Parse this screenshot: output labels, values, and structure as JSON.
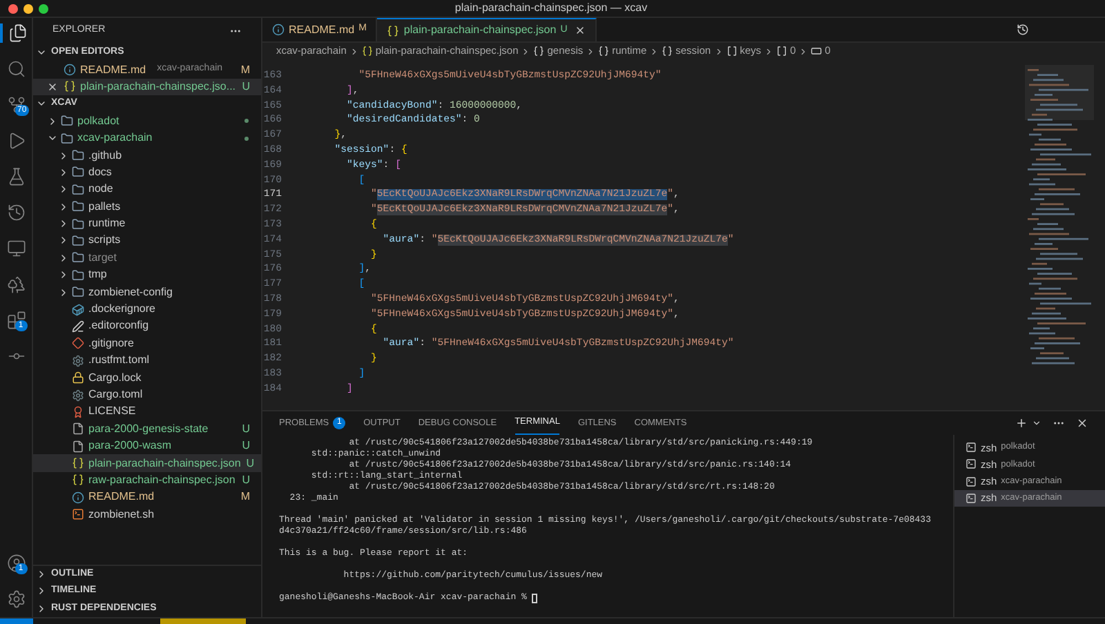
{
  "window": {
    "title": "plain-parachain-chainspec.json — xcav"
  },
  "activity_bar": {
    "items": [
      {
        "kind": "files",
        "selected": true
      },
      {
        "kind": "search",
        "selected": false
      },
      {
        "kind": "source-control",
        "selected": false,
        "badge": "70"
      },
      {
        "kind": "run",
        "selected": false
      },
      {
        "kind": "testing",
        "selected": false
      },
      {
        "kind": "history",
        "selected": false
      },
      {
        "kind": "remote",
        "selected": false
      },
      {
        "kind": "tree",
        "selected": false
      },
      {
        "kind": "extensions",
        "selected": false,
        "badge": "1"
      },
      {
        "kind": "commit",
        "selected": false
      }
    ],
    "bottom": [
      {
        "kind": "account",
        "badge": "1"
      },
      {
        "kind": "settings"
      }
    ]
  },
  "sidebar": {
    "title": "EXPLORER",
    "open_editors": {
      "title": "OPEN EDITORS",
      "expanded": true,
      "items": [
        {
          "name": "README.md",
          "description": "xcav-parachain",
          "badge": "M",
          "color": "#e2c08d",
          "kind": "info",
          "selected": false,
          "closable": false
        },
        {
          "name": "plain-parachain-chainspec.jso...",
          "badge": "U",
          "color": "#73c991",
          "kind": "json",
          "selected": true,
          "closable": true
        }
      ]
    },
    "workspace": {
      "title": "XCAV",
      "expanded": true,
      "tree": [
        {
          "name": "polkadot",
          "kind": "folder",
          "expanded": false,
          "color": "#73c991",
          "dot": true,
          "selected": false
        },
        {
          "name": "xcav-parachain",
          "kind": "folder",
          "expanded": true,
          "color": "#73c991",
          "dot": true,
          "selected": false,
          "children": [
            {
              "name": ".github",
              "kind": "folder",
              "expanded": false,
              "color": "#cccccc",
              "selected": false
            },
            {
              "name": "docs",
              "kind": "folder",
              "expanded": false,
              "color": "#cccccc",
              "selected": false
            },
            {
              "name": "node",
              "kind": "folder",
              "expanded": false,
              "color": "#cccccc",
              "selected": false
            },
            {
              "name": "pallets",
              "kind": "folder",
              "expanded": false,
              "color": "#cccccc",
              "selected": false
            },
            {
              "name": "runtime",
              "kind": "folder",
              "expanded": false,
              "color": "#cccccc",
              "selected": false
            },
            {
              "name": "scripts",
              "kind": "folder",
              "expanded": false,
              "color": "#cccccc",
              "selected": false
            },
            {
              "name": "target",
              "kind": "folder",
              "expanded": false,
              "color": "#8c8c8c",
              "selected": false
            },
            {
              "name": "tmp",
              "kind": "folder",
              "expanded": false,
              "color": "#cccccc",
              "selected": false
            },
            {
              "name": "zombienet-config",
              "kind": "folder",
              "expanded": false,
              "color": "#cccccc",
              "selected": false
            },
            {
              "name": ".dockerignore",
              "kind": "docker",
              "color": "#cccccc",
              "selected": false
            },
            {
              "name": ".editorconfig",
              "kind": "editorconfig",
              "color": "#cccccc",
              "selected": false
            },
            {
              "name": ".gitignore",
              "kind": "git",
              "color": "#cccccc",
              "selected": false
            },
            {
              "name": ".rustfmt.toml",
              "kind": "gear",
              "color": "#cccccc",
              "selected": false
            },
            {
              "name": "Cargo.lock",
              "kind": "lock",
              "color": "#cccccc",
              "selected": false
            },
            {
              "name": "Cargo.toml",
              "kind": "gear",
              "color": "#cccccc",
              "selected": false
            },
            {
              "name": "LICENSE",
              "kind": "license",
              "color": "#cccccc",
              "selected": false
            },
            {
              "name": "para-2000-genesis-state",
              "kind": "file",
              "color": "#73c991",
              "badge": "U",
              "selected": false
            },
            {
              "name": "para-2000-wasm",
              "kind": "file",
              "color": "#73c991",
              "badge": "U",
              "selected": false
            },
            {
              "name": "plain-parachain-chainspec.json",
              "kind": "json",
              "color": "#73c991",
              "badge": "U",
              "selected": true
            },
            {
              "name": "raw-parachain-chainspec.json",
              "kind": "json",
              "color": "#73c991",
              "badge": "U",
              "selected": false
            },
            {
              "name": "README.md",
              "kind": "info",
              "color": "#e2c08d",
              "badge": "M",
              "selected": false
            },
            {
              "name": "zombienet.sh",
              "kind": "shell",
              "color": "#cccccc",
              "selected": false
            }
          ]
        }
      ]
    },
    "sections": [
      {
        "title": "OUTLINE",
        "expanded": false
      },
      {
        "title": "TIMELINE",
        "expanded": false
      },
      {
        "title": "RUST DEPENDENCIES",
        "expanded": false
      }
    ]
  },
  "tabs": [
    {
      "label": "README.md",
      "badge": "M",
      "kind": "info",
      "color": "#e2c08d",
      "selected": false,
      "closable": false
    },
    {
      "label": "plain-parachain-chainspec.json",
      "badge": "U",
      "kind": "json",
      "color": "#73c991",
      "selected": true,
      "closable": true
    }
  ],
  "breadcrumbs": [
    {
      "kind": "none",
      "label": "xcav-parachain"
    },
    {
      "kind": "json",
      "label": "plain-parachain-chainspec.json"
    },
    {
      "kind": "object",
      "label": "genesis"
    },
    {
      "kind": "object",
      "label": "runtime"
    },
    {
      "kind": "object",
      "label": "session"
    },
    {
      "kind": "array",
      "label": "keys"
    },
    {
      "kind": "array",
      "label": "0"
    },
    {
      "kind": "string",
      "label": "0"
    }
  ],
  "code": {
    "lines": [
      {
        "number": "163",
        "current": false,
        "tokens": [
          {
            "kind": "string",
            "text": "\"5FHneW46xGXgs5mUiveU4sbTyGBzmstUspZC92UhjJM694ty\""
          }
        ]
      },
      {
        "number": "164",
        "current": false,
        "tokens": [
          {
            "kind": "close",
            "text": "]"
          },
          {
            "kind": "punct",
            "text": ","
          }
        ]
      },
      {
        "number": "165",
        "current": false,
        "tokens": [
          {
            "kind": "key",
            "text": "\"candidacyBond\""
          },
          {
            "kind": "punct",
            "text": ": "
          },
          {
            "kind": "number",
            "text": "16000000000"
          },
          {
            "kind": "punct",
            "text": ","
          }
        ]
      },
      {
        "number": "166",
        "current": false,
        "tokens": [
          {
            "kind": "key",
            "text": "\"desiredCandidates\""
          },
          {
            "kind": "punct",
            "text": ": "
          },
          {
            "kind": "number",
            "text": "0"
          }
        ]
      },
      {
        "number": "167",
        "current": false,
        "tokens": [
          {
            "kind": "close",
            "text": "}"
          },
          {
            "kind": "punct",
            "text": ","
          }
        ]
      },
      {
        "number": "168",
        "current": false,
        "tokens": [
          {
            "kind": "key",
            "text": "\"session\""
          },
          {
            "kind": "punct",
            "text": ": "
          },
          {
            "kind": "open",
            "text": "{"
          }
        ]
      },
      {
        "number": "169",
        "current": false,
        "tokens": [
          {
            "kind": "key",
            "text": "\"keys\""
          },
          {
            "kind": "punct",
            "text": ": "
          },
          {
            "kind": "open",
            "text": "["
          }
        ]
      },
      {
        "number": "170",
        "current": false,
        "tokens": [
          {
            "kind": "open",
            "text": "["
          }
        ]
      },
      {
        "number": "171",
        "current": true,
        "tokens": [
          {
            "kind": "string",
            "text": "\""
          },
          {
            "kind": "string",
            "text": "5EcKtQoUJAJc6Ekz3XNaR9LRsDWrqCMVnZNAa7N21JzuZL7e",
            "selected": true
          },
          {
            "kind": "string",
            "text": "\""
          },
          {
            "kind": "punct",
            "text": ","
          }
        ]
      },
      {
        "number": "172",
        "current": false,
        "tokens": [
          {
            "kind": "string",
            "text": "\""
          },
          {
            "kind": "string",
            "text": "5EcKtQoUJAJc6Ekz3XNaR9LRsDWrqCMVnZNAa7N21JzuZL7e",
            "occurrence": true
          },
          {
            "kind": "string",
            "text": "\""
          },
          {
            "kind": "punct",
            "text": ","
          }
        ]
      },
      {
        "number": "173",
        "current": false,
        "tokens": [
          {
            "kind": "open",
            "text": "{"
          }
        ]
      },
      {
        "number": "174",
        "current": false,
        "tokens": [
          {
            "kind": "key",
            "text": "\"aura\""
          },
          {
            "kind": "punct",
            "text": ": "
          },
          {
            "kind": "string",
            "text": "\""
          },
          {
            "kind": "string",
            "text": "5EcKtQoUJAJc6Ekz3XNaR9LRsDWrqCMVnZNAa7N21JzuZL7e",
            "occurrence": true
          },
          {
            "kind": "string",
            "text": "\""
          }
        ]
      },
      {
        "number": "175",
        "current": false,
        "tokens": [
          {
            "kind": "close",
            "text": "}"
          }
        ]
      },
      {
        "number": "176",
        "current": false,
        "tokens": [
          {
            "kind": "close",
            "text": "]"
          },
          {
            "kind": "punct",
            "text": ","
          }
        ]
      },
      {
        "number": "177",
        "current": false,
        "tokens": [
          {
            "kind": "open",
            "text": "["
          }
        ]
      },
      {
        "number": "178",
        "current": false,
        "tokens": [
          {
            "kind": "string",
            "text": "\"5FHneW46xGXgs5mUiveU4sbTyGBzmstUspZC92UhjJM694ty\""
          },
          {
            "kind": "punct",
            "text": ","
          }
        ]
      },
      {
        "number": "179",
        "current": false,
        "tokens": [
          {
            "kind": "string",
            "text": "\"5FHneW46xGXgs5mUiveU4sbTyGBzmstUspZC92UhjJM694ty\""
          },
          {
            "kind": "punct",
            "text": ","
          }
        ]
      },
      {
        "number": "180",
        "current": false,
        "tokens": [
          {
            "kind": "open",
            "text": "{"
          }
        ]
      },
      {
        "number": "181",
        "current": false,
        "tokens": [
          {
            "kind": "key",
            "text": "\"aura\""
          },
          {
            "kind": "punct",
            "text": ": "
          },
          {
            "kind": "string",
            "text": "\"5FHneW46xGXgs5mUiveU4sbTyGBzmstUspZC92UhjJM694ty\""
          }
        ]
      },
      {
        "number": "182",
        "current": false,
        "tokens": [
          {
            "kind": "close",
            "text": "}"
          }
        ]
      },
      {
        "number": "183",
        "current": false,
        "tokens": [
          {
            "kind": "close",
            "text": "]"
          }
        ]
      },
      {
        "number": "184",
        "current": false,
        "tokens": [
          {
            "kind": "close",
            "text": "]"
          }
        ]
      }
    ]
  },
  "panel": {
    "tabs": [
      {
        "label": "PROBLEMS",
        "badge": "1",
        "selected": false
      },
      {
        "label": "OUTPUT",
        "selected": false
      },
      {
        "label": "DEBUG CONSOLE",
        "selected": false
      },
      {
        "label": "TERMINAL",
        "selected": true
      },
      {
        "label": "GITLENS",
        "selected": false
      },
      {
        "label": "COMMENTS",
        "selected": false
      }
    ],
    "terminal": {
      "blocks": [
        [
          "             at /rustc/90c541806f23a127002de5b4038be731ba1458ca/library/std/src/panicking.rs:449:19",
          "      std::panic::catch_unwind",
          "             at /rustc/90c541806f23a127002de5b4038be731ba1458ca/library/std/src/panic.rs:140:14",
          "      std::rt::lang_start_internal",
          "             at /rustc/90c541806f23a127002de5b4038be731ba1458ca/library/std/src/rt.rs:148:20",
          "  23: _main"
        ],
        [
          "Thread 'main' panicked at 'Validator in session 1 missing keys!', /Users/ganesholi/.cargo/git/checkouts/substrate-7e08433",
          "d4c370a21/ff24c60/frame/session/src/lib.rs:486"
        ],
        [
          "This is a bug. Please report it at:"
        ],
        [
          "            https://github.com/paritytech/cumulus/issues/new"
        ]
      ],
      "prompt": "ganesholi@Ganeshs-MacBook-Air xcav-parachain % "
    },
    "sessions": [
      {
        "shell": "zsh",
        "name": "polkadot",
        "selected": false
      },
      {
        "shell": "zsh",
        "name": "polkadot",
        "selected": false
      },
      {
        "shell": "zsh",
        "name": "xcav-parachain",
        "selected": false
      },
      {
        "shell": "zsh",
        "name": "xcav-parachain",
        "selected": true
      }
    ]
  }
}
